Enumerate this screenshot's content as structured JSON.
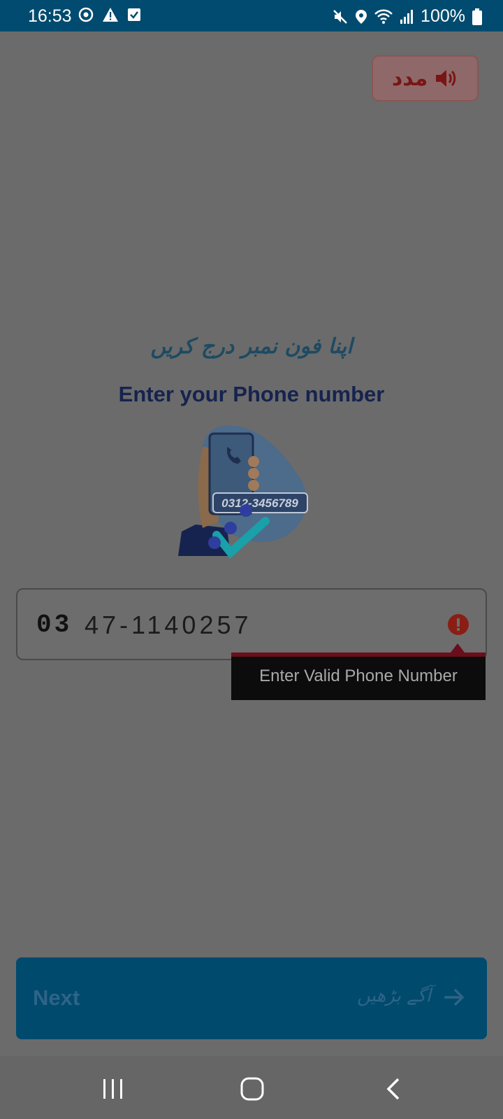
{
  "status_bar": {
    "time": "16:53",
    "battery": "100%",
    "icons_left": [
      "eye-sync-icon",
      "warning-icon",
      "checkbox-icon"
    ],
    "icons_right": [
      "mute-icon",
      "location-icon",
      "wifi-icon",
      "signal-icon",
      "battery-icon"
    ]
  },
  "help_button": {
    "label": "مدد",
    "icon": "speaker-icon"
  },
  "title_urdu": "اپنا فون نمبر درج کریں",
  "title_en": "Enter your Phone number",
  "illustration": {
    "caption": "0312-3456789"
  },
  "phone_field": {
    "prefix": "03",
    "value": "47-1140257",
    "error_icon": "error-icon"
  },
  "error_tooltip": {
    "text": "Enter Valid Phone Number"
  },
  "next_button": {
    "label": "Next",
    "label_urdu": "آگے بڑھیں",
    "icon": "arrow-right-icon"
  },
  "nav_bar": {
    "items": [
      "recent-apps-icon",
      "home-icon",
      "back-icon"
    ]
  },
  "colors": {
    "status_bar": "#004b6f",
    "next_button": "#004a6e",
    "title_en": "#16234f",
    "error": "#8a1e14"
  }
}
